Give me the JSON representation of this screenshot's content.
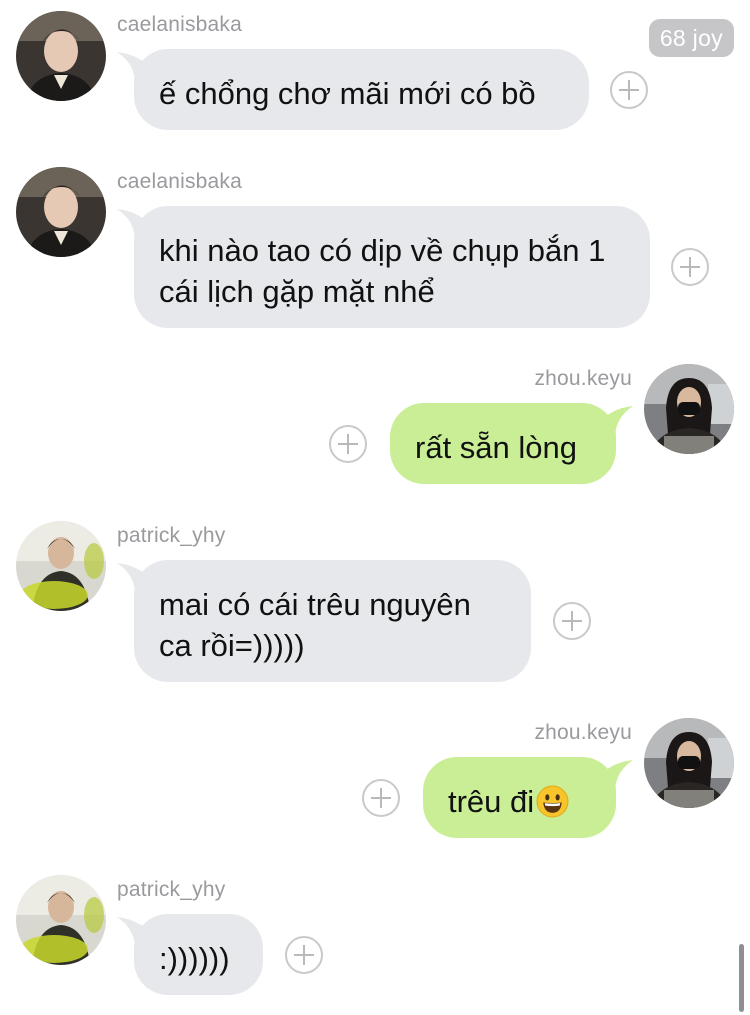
{
  "header": {
    "badge": "68 joy"
  },
  "messages": [
    {
      "user": "caelanisbaka",
      "text": "ế chổng chơ mãi mới có bồ",
      "side": "in"
    },
    {
      "user": "caelanisbaka",
      "text": "khi nào tao có dịp về chụp bắn 1 cái lịch gặp mặt nhể",
      "side": "in"
    },
    {
      "user": "zhou.keyu",
      "text": "rất sẵn lòng",
      "side": "out"
    },
    {
      "user": "patrick_yhy",
      "text": "mai có cái trêu nguyên ca rồi=)))))",
      "side": "in"
    },
    {
      "user": "zhou.keyu",
      "text": "trêu đi",
      "emoji": "grinning-face-emoji",
      "side": "out"
    },
    {
      "user": "patrick_yhy",
      "text": ":))))))",
      "side": "in"
    }
  ],
  "colors": {
    "incoming_bubble": "#e6e8eb",
    "outgoing_bubble": "#caee96",
    "username": "#9a9a9e",
    "badge_bg": "#c6c6c8"
  },
  "icons": {
    "react": "add-reaction-icon",
    "avatar_caelan": "avatar-caelanisbaka",
    "avatar_zhou": "avatar-zhou-keyu",
    "avatar_patrick": "avatar-patrick-yhy"
  }
}
